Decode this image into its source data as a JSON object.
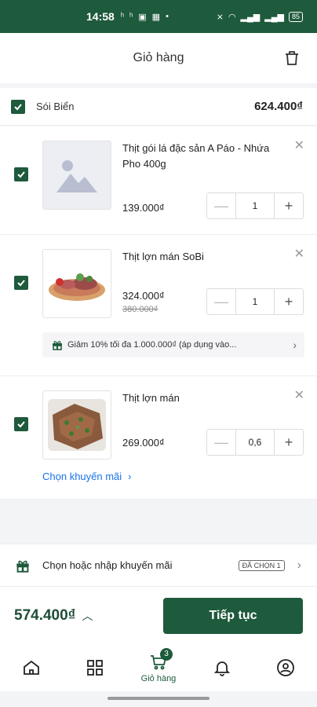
{
  "status_bar": {
    "time": "14:58",
    "battery": "85"
  },
  "header": {
    "title": "Giỏ hàng"
  },
  "shop": {
    "name": "Sói Biển",
    "total": "624.400₫"
  },
  "items": [
    {
      "name": "Thịt gói lá đặc sản A Páo - Nhứa Pho 400g",
      "price": "139.000₫",
      "quantity": "1",
      "image": "image-placeholder-icon",
      "checked": true
    },
    {
      "name": "Thịt lợn mán SoBi",
      "price": "324.000₫",
      "old_price": "380.000₫",
      "quantity": "1",
      "image": "meat-platter-photo",
      "checked": true,
      "promo": "Giảm 10% tối đa 1.000.000₫ (áp dụng vào..."
    },
    {
      "name": "Thịt lợn mán",
      "price": "269.000₫",
      "quantity": "0,6",
      "image": "cooked-pork-photo",
      "checked": true,
      "choose_promo": "Chọn khuyến mãi"
    }
  ],
  "voucher": {
    "text": "Chọn hoặc nhập khuyến mãi",
    "tag": "ĐÃ CHỌN 1"
  },
  "checkout": {
    "total": "574.400₫",
    "button": "Tiếp tục"
  },
  "nav": [
    {
      "icon": "home-icon",
      "label": ""
    },
    {
      "icon": "grid-icon",
      "label": ""
    },
    {
      "icon": "cart-icon",
      "label": "Giỏ hàng",
      "badge": "3",
      "active": true
    },
    {
      "icon": "bell-icon",
      "label": ""
    },
    {
      "icon": "user-icon",
      "label": ""
    }
  ],
  "colors": {
    "primary": "#1e5a3c",
    "link": "#1a73e8",
    "background": "#f3f4f6"
  }
}
